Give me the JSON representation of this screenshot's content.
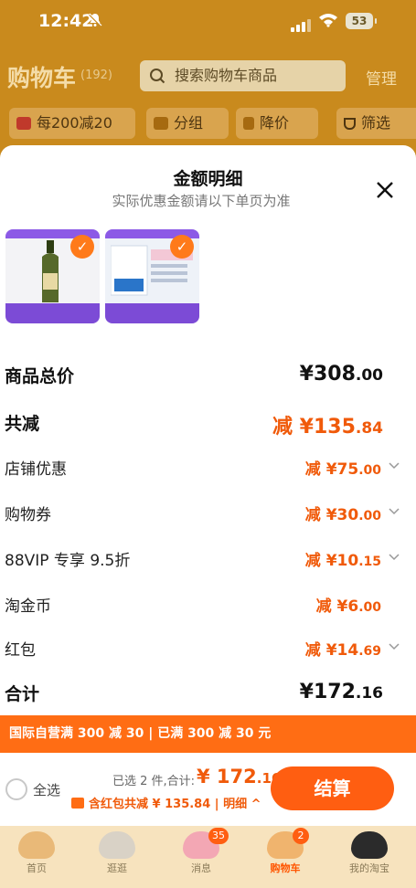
{
  "status_bar": {
    "time": "12:42",
    "battery": "53"
  },
  "header": {
    "title": "购物车",
    "count": "(192)",
    "search_placeholder": "搜索购物车商品",
    "manage_label": "管理"
  },
  "filters": [
    {
      "label": "每200减20",
      "icon": "coupon-icon"
    },
    {
      "label": "分组",
      "icon": "folder-icon"
    },
    {
      "label": "降价",
      "icon": "price-drop-icon"
    },
    {
      "label": "筛选",
      "icon": "filter-icon"
    }
  ],
  "sheet": {
    "title": "金额明细",
    "subtitle": "实际优惠金额请以下单页为准",
    "rows": {
      "subtotal": {
        "label": "商品总价",
        "int": "¥308",
        "dec": ".00"
      },
      "total_discount": {
        "label": "共减",
        "int": "减 ¥135",
        "dec": ".84"
      },
      "store": {
        "label": "店铺优惠",
        "int": "减 ¥75",
        "dec": ".00"
      },
      "voucher": {
        "label": "购物券",
        "int": "减 ¥30",
        "dec": ".00"
      },
      "vip": {
        "label": "88VIP 专享 9.5折",
        "int": "减 ¥10",
        "dec": ".15"
      },
      "coins": {
        "label": "淘金币",
        "int": "减 ¥6",
        "dec": ".00"
      },
      "redpacket": {
        "label": "红包",
        "int": "减 ¥14",
        "dec": ".69"
      },
      "total": {
        "label": "合计",
        "int": "¥172",
        "dec": ".16"
      }
    }
  },
  "promo_banner": "国际自营满 300 减 30 | 已满 300 减 30 元",
  "checkout": {
    "select_all": "全选",
    "selected_info": "已选 2 件,合计:",
    "total_int": "¥ 172",
    "total_dec": ".16",
    "discount_line": "含红包共减 ¥ 135.84",
    "detail_toggle": "| 明细 ^",
    "settle": "结算"
  },
  "tabs": [
    {
      "label": "首页",
      "badge": ""
    },
    {
      "label": "逛逛",
      "badge": ""
    },
    {
      "label": "消息",
      "badge": "35"
    },
    {
      "label": "购物车",
      "badge": "2",
      "active": true
    },
    {
      "label": "我的淘宝",
      "badge": ""
    }
  ],
  "colors": {
    "accent": "#ff5e11",
    "banner": "#ff6d14",
    "header_dim": "#c98a1d"
  }
}
